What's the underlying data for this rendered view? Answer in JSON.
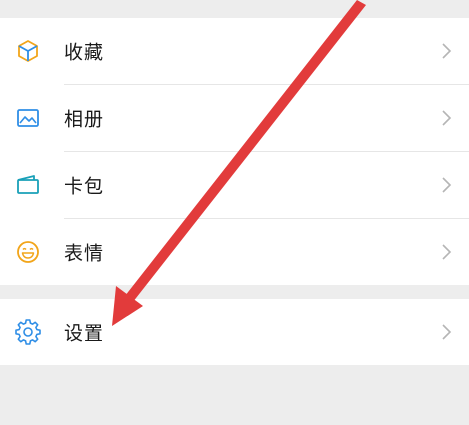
{
  "menu": {
    "items": [
      {
        "label": "收藏",
        "icon": "favorites-cube-icon"
      },
      {
        "label": "相册",
        "icon": "album-picture-icon"
      },
      {
        "label": "卡包",
        "icon": "card-wallet-icon"
      },
      {
        "label": "表情",
        "icon": "sticker-smiley-icon"
      }
    ],
    "settings": {
      "label": "设置",
      "icon": "gear-icon"
    }
  },
  "colors": {
    "favorites": "#f2a51a",
    "album": "#2f8ee6",
    "cards": "#19a0b8",
    "stickers": "#f2a51a",
    "settings": "#2f8ee6",
    "arrow": "#e23b3b",
    "chevron": "#b5b5b5"
  }
}
